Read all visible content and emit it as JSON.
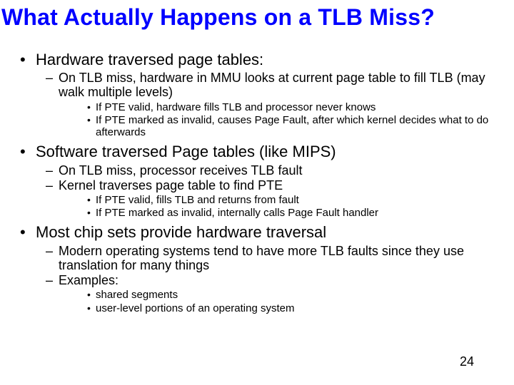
{
  "title": "What Actually Happens on a TLB Miss?",
  "page_number": "24",
  "bullets": [
    {
      "text": "Hardware traversed page tables:",
      "sub": [
        {
          "text": "On TLB miss, hardware in MMU looks at current page table to fill TLB (may walk multiple levels)",
          "sub": [
            "If PTE valid, hardware fills TLB and processor never knows",
            "If PTE marked as invalid, causes Page Fault, after which kernel decides what to do afterwards"
          ]
        }
      ]
    },
    {
      "text": "Software traversed Page tables (like MIPS)",
      "sub": [
        {
          "text": "On TLB miss, processor receives TLB fault"
        },
        {
          "text": "Kernel traverses page table to find PTE",
          "sub": [
            "If PTE valid, fills TLB and returns from fault",
            "If PTE marked as invalid, internally calls Page Fault handler"
          ]
        }
      ]
    },
    {
      "text": "Most chip sets provide hardware traversal",
      "sub": [
        {
          "text": "Modern operating systems tend to have more TLB faults since they use translation for many things"
        },
        {
          "text": "Examples:",
          "sub": [
            "shared segments",
            "user-level portions of an operating system"
          ]
        }
      ]
    }
  ]
}
